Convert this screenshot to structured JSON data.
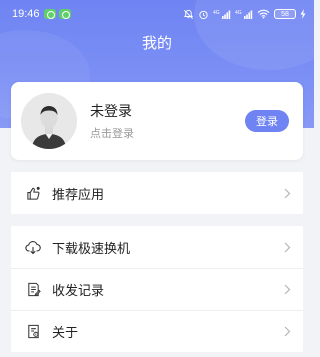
{
  "status_bar": {
    "time": "19:46",
    "battery": "58",
    "signal_1": "4G",
    "signal_2": "4G"
  },
  "header": {
    "title": "我的",
    "accent_color": "#6f84f2"
  },
  "profile": {
    "name": "未登录",
    "subtitle": "点击登录",
    "login_button": "登录"
  },
  "menu_groups": [
    {
      "items": [
        {
          "label": "推荐应用",
          "icon": "thumbs-up-icon"
        }
      ]
    },
    {
      "items": [
        {
          "label": "下载极速换机",
          "icon": "cloud-download-icon"
        },
        {
          "label": "收发记录",
          "icon": "record-icon"
        },
        {
          "label": "关于",
          "icon": "about-icon"
        }
      ]
    }
  ]
}
